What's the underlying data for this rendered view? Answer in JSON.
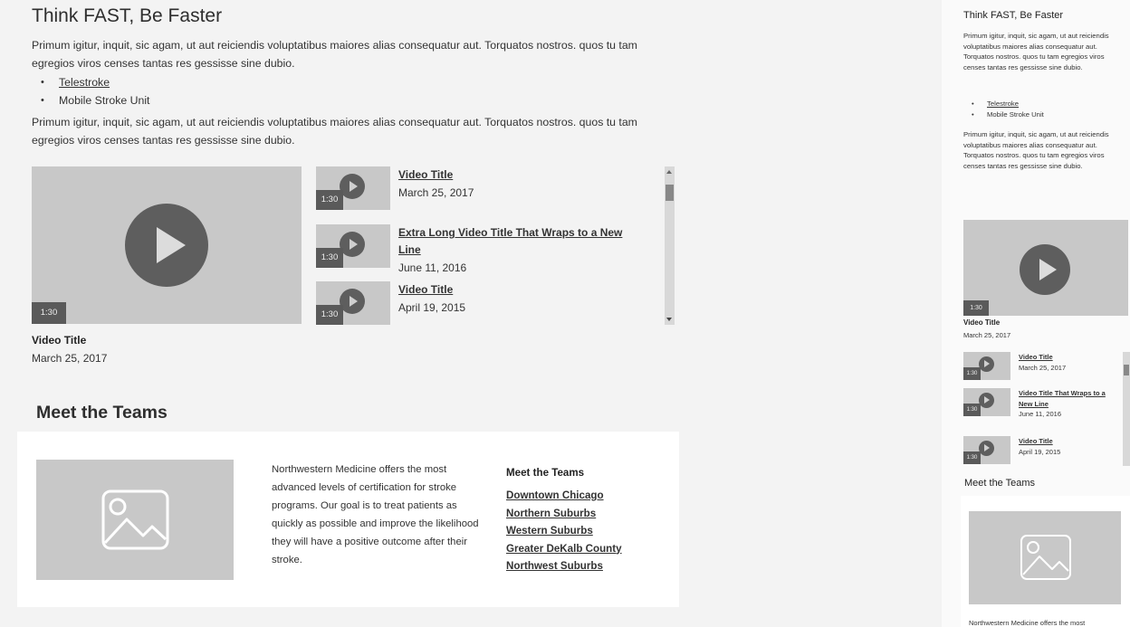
{
  "main": {
    "title": "Think FAST, Be Faster",
    "paragraph_1": "Primum igitur, inquit, sic agam, ut aut reiciendis voluptatibus maiores alias consequatur aut. Torquatos nostros. quos tu tam egregios viros censes tantas res gessisse sine dubio.",
    "bullets": [
      "Telestroke",
      "Mobile Stroke Unit"
    ],
    "paragraph_2": "Primum igitur, inquit, sic agam, ut aut reiciendis voluptatibus maiores alias consequatur aut. Torquatos nostros. quos tu tam egregios viros censes tantas res gessisse sine dubio.",
    "featured_video": {
      "duration": "1:30",
      "title": "Video Title",
      "date": "March 25, 2017"
    },
    "playlist": [
      {
        "duration": "1:30",
        "title": "Video Title",
        "date": "March 25, 2017"
      },
      {
        "duration": "1:30",
        "title": "Extra Long Video Title That Wraps to a New Line",
        "date": "June 11, 2016"
      },
      {
        "duration": "1:30",
        "title": "Video Title",
        "date": "April 19, 2015"
      }
    ],
    "teams_heading": "Meet the Teams",
    "teams_text": "Northwestern Medicine offers the most advanced levels of certification for stroke programs. Our goal is to treat patients as quickly as possible and improve the likelihood they will have a positive outcome after their stroke.",
    "teams_links_heading": "Meet the Teams",
    "teams_links": [
      "Downtown Chicago",
      "Northern Suburbs",
      "Western Suburbs",
      "Greater DeKalb County",
      "Northwest Suburbs"
    ]
  },
  "mobile": {
    "title": "Think FAST, Be Faster",
    "paragraph_1": "Primum igitur, inquit, sic agam, ut aut reiciendis voluptatibus maiores alias consequatur aut. Torquatos nostros. quos tu tam egregios viros censes tantas res gessisse sine dubio.",
    "bullets": [
      "Telestroke",
      "Mobile Stroke Unit"
    ],
    "paragraph_2": "Primum igitur, inquit, sic agam, ut aut reiciendis voluptatibus maiores alias consequatur aut. Torquatos nostros. quos tu tam egregios viros censes tantas res gessisse sine dubio.",
    "featured_video": {
      "duration": "1:30",
      "title": "Video Title",
      "date": "March 25, 2017"
    },
    "playlist": [
      {
        "duration": "1:30",
        "title": "Video Title",
        "date": "March 25, 2017"
      },
      {
        "duration": "1:30",
        "title": "Video Title That Wraps to a New Line",
        "date": "June 11, 2016"
      },
      {
        "duration": "1:30",
        "title": "Video Title",
        "date": "April 19, 2015"
      }
    ],
    "teams_heading": "Meet the Teams",
    "teams_text": "Northwestern Medicine offers the most"
  }
}
